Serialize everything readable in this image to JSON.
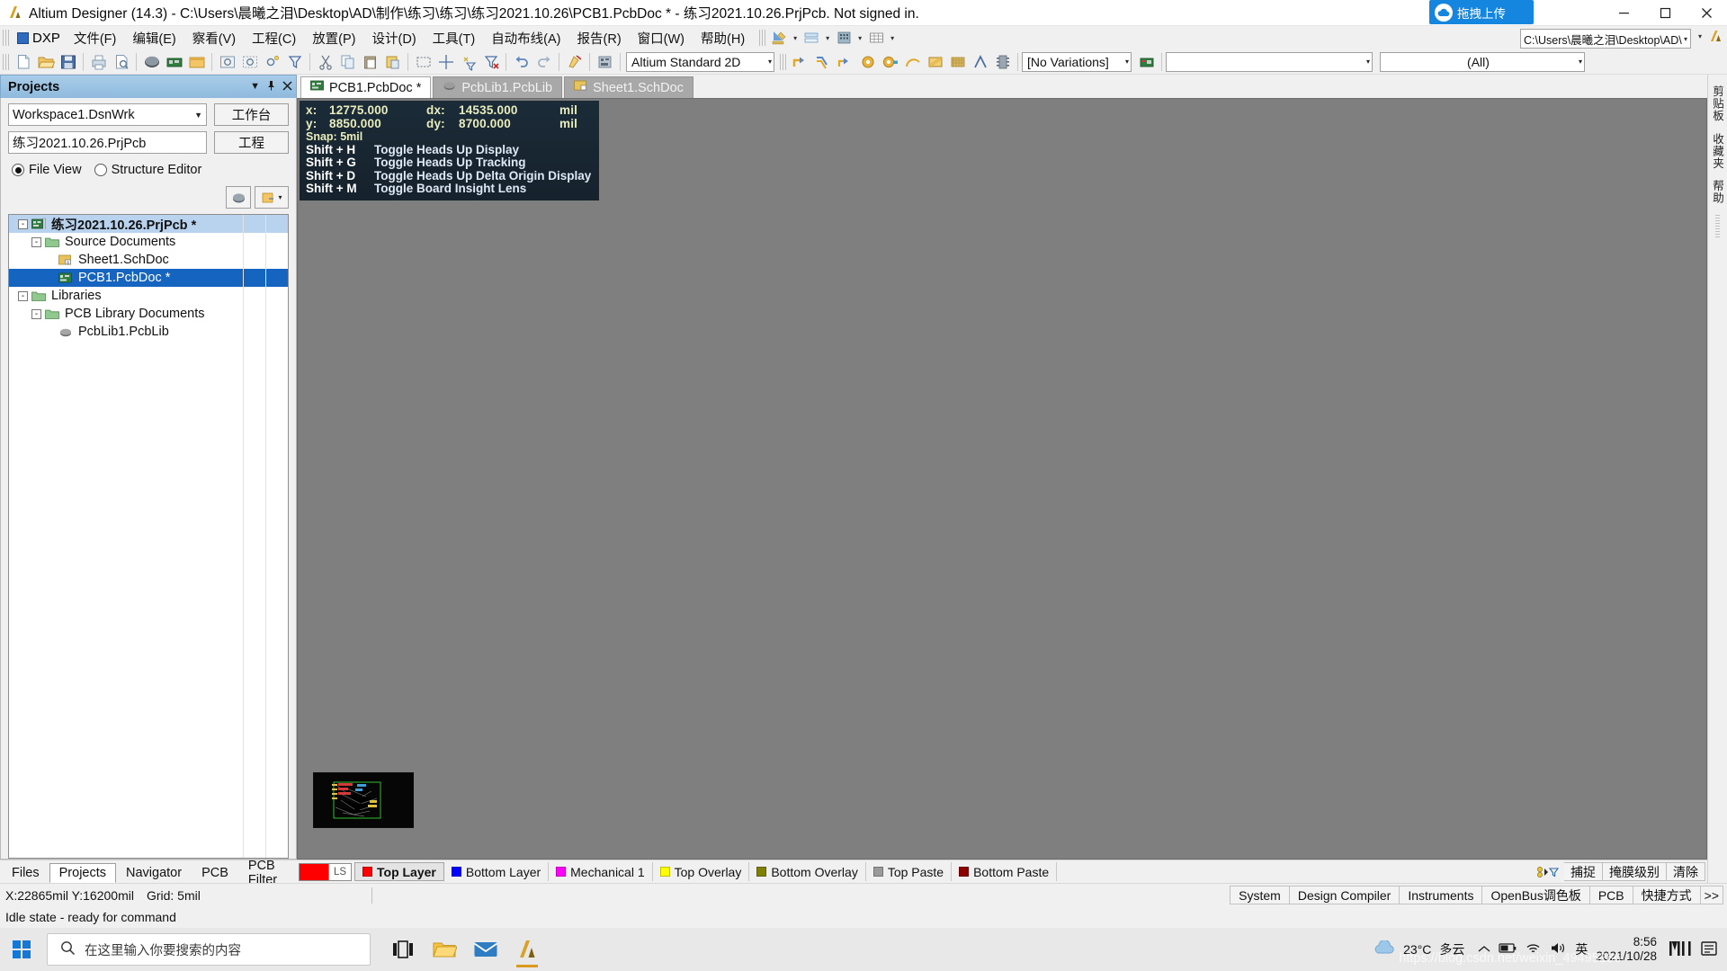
{
  "window": {
    "title": "Altium Designer (14.3) - C:\\Users\\晨曦之泪\\Desktop\\AD\\制作\\练习\\练习\\练习2021.10.26\\PCB1.PcbDoc * - 练习2021.10.26.PrjPcb. Not signed in.",
    "app_icon": "altium-logo-icon",
    "minimize": "–",
    "maximize": "□",
    "close": "✕"
  },
  "upload_widget": {
    "label": "拖拽上传",
    "icon": "cloud-upload-icon",
    "color": "#1586e0"
  },
  "menu": {
    "dxp_label": "DXP",
    "items": [
      {
        "label": "文件(F)",
        "key": "F"
      },
      {
        "label": "编辑(E)",
        "key": "E"
      },
      {
        "label": "察看(V)",
        "key": "V"
      },
      {
        "label": "工程(C)",
        "key": "C"
      },
      {
        "label": "放置(P)",
        "key": "P"
      },
      {
        "label": "设计(D)",
        "key": "D"
      },
      {
        "label": "工具(T)",
        "key": "T"
      },
      {
        "label": "自动布线(A)",
        "key": "A"
      },
      {
        "label": "报告(R)",
        "key": "R"
      },
      {
        "label": "窗口(W)",
        "key": "W"
      },
      {
        "label": "帮助(H)",
        "key": "H"
      }
    ],
    "path_value": "C:\\Users\\晨曦之泪\\Desktop\\AD\\"
  },
  "toolbar": {
    "view_mode": "Altium Standard 2D",
    "variations": "[No Variations]",
    "filter_all": "(All)",
    "filter_blank": ""
  },
  "projects_panel": {
    "title": "Projects",
    "header_icons": [
      "chevron-down-icon",
      "pin-icon",
      "close-icon"
    ],
    "workspace_value": "Workspace1.DsnWrk",
    "workspace_button": "工作台",
    "project_value": "练习2021.10.26.PrjPcb",
    "project_button": "工程",
    "view_modes": [
      {
        "label": "File View",
        "selected": true
      },
      {
        "label": "Structure Editor",
        "selected": false
      }
    ],
    "tree": [
      {
        "label": "练习2021.10.26.PrjPcb *",
        "indent": 0,
        "expander": "-",
        "icon": "project-icon",
        "state": "highlight",
        "bold": true
      },
      {
        "label": "Source Documents",
        "indent": 1,
        "expander": "-",
        "icon": "folder-icon",
        "state": "",
        "bold": false
      },
      {
        "label": "Sheet1.SchDoc",
        "indent": 2,
        "expander": "",
        "icon": "schdoc-icon",
        "state": "",
        "bold": false
      },
      {
        "label": "PCB1.PcbDoc *",
        "indent": 2,
        "expander": "",
        "icon": "pcbdoc-icon",
        "state": "selected",
        "bold": false
      },
      {
        "label": "Libraries",
        "indent": 0,
        "expander": "-",
        "icon": "folder-icon",
        "state": "",
        "bold": false
      },
      {
        "label": "PCB Library Documents",
        "indent": 1,
        "expander": "-",
        "icon": "folder-icon",
        "state": "",
        "bold": false
      },
      {
        "label": "PcbLib1.PcbLib",
        "indent": 2,
        "expander": "",
        "icon": "pcblib-icon",
        "state": "",
        "bold": false
      }
    ],
    "bottom_tabs": [
      {
        "label": "Files",
        "active": false
      },
      {
        "label": "Projects",
        "active": true
      },
      {
        "label": "Navigator",
        "active": false
      },
      {
        "label": "PCB",
        "active": false
      },
      {
        "label": "PCB Filter",
        "active": false
      }
    ]
  },
  "document_tabs": [
    {
      "label": "PCB1.PcbDoc *",
      "icon": "pcbdoc-icon",
      "active": true
    },
    {
      "label": "PcbLib1.PcbLib",
      "icon": "pcblib-icon",
      "active": false
    },
    {
      "label": "Sheet1.SchDoc",
      "icon": "schdoc-icon",
      "active": false
    }
  ],
  "heads_up_display": {
    "x_label": "x:",
    "x_value": "12775.000",
    "dx_label": "dx:",
    "dx_value": "14535.000",
    "dx_unit": "mil",
    "y_label": "y:",
    "y_value": "8850.000",
    "dy_label": "dy:",
    "dy_value": "8700.000",
    "dy_unit": "mil",
    "snap": "Snap: 5mil",
    "shortcuts": [
      {
        "keys": "Shift + H",
        "action": "Toggle Heads Up Display"
      },
      {
        "keys": "Shift + G",
        "action": "Toggle Heads Up Tracking"
      },
      {
        "keys": "Shift + D",
        "action": "Toggle Heads Up Delta Origin Display"
      },
      {
        "keys": "Shift + M",
        "action": "Toggle Board Insight Lens"
      }
    ]
  },
  "layer_bar": {
    "ls_label": "LS",
    "ls_color": "#ff0000",
    "layers": [
      {
        "label": "Top Layer",
        "color": "#ff0000",
        "active": true
      },
      {
        "label": "Bottom Layer",
        "color": "#0000ff",
        "active": false
      },
      {
        "label": "Mechanical 1",
        "color": "#ff00ff",
        "active": false
      },
      {
        "label": "Top Overlay",
        "color": "#ffff00",
        "active": false
      },
      {
        "label": "Bottom Overlay",
        "color": "#808000",
        "active": false
      },
      {
        "label": "Top Paste",
        "color": "#9a9a9a",
        "active": false
      },
      {
        "label": "Bottom Paste",
        "color": "#8b0000",
        "active": false
      }
    ],
    "right_buttons": [
      "捕捉",
      "掩膜级别",
      "清除"
    ],
    "right_icon": "snap-filter-icon"
  },
  "right_dock": {
    "tabs": [
      "剪贴板",
      "收藏夹",
      "帮助"
    ]
  },
  "status": {
    "coords": "X:22865mil Y:16200mil",
    "grid": "Grid: 5mil",
    "message": "Idle state - ready for command",
    "panels": [
      {
        "label": "System",
        "key": "S"
      },
      {
        "label": "Design Compiler",
        "key": "D"
      },
      {
        "label": "Instruments",
        "key": "I"
      },
      {
        "label": "OpenBus调色板",
        "key": ""
      },
      {
        "label": "PCB",
        "key": "P"
      },
      {
        "label": "快捷方式",
        "key": ""
      }
    ],
    "overflow": ">>"
  },
  "taskbar": {
    "start_icon": "windows-start-icon",
    "search_placeholder": "在这里输入你要搜索的内容",
    "search_icon": "search-icon",
    "apps": [
      {
        "name": "task-view-icon",
        "active": false
      },
      {
        "name": "file-explorer-icon",
        "active": false
      },
      {
        "name": "mail-icon",
        "active": false
      },
      {
        "name": "altium-designer-icon",
        "active": true
      }
    ],
    "weather": {
      "icon": "cloud-icon",
      "temp": "23°C",
      "desc": "多云"
    },
    "tray_icons": [
      "chevron-up-icon",
      "battery-icon",
      "wifi-icon",
      "volume-icon"
    ],
    "ime": "英",
    "clock_time": "8:56",
    "clock_date": "2021/10/28",
    "extra_icons": [
      "m-logo-icon",
      "notification-icon"
    ]
  },
  "watermark": "https://blog.csdn.net/weixin_49495286"
}
